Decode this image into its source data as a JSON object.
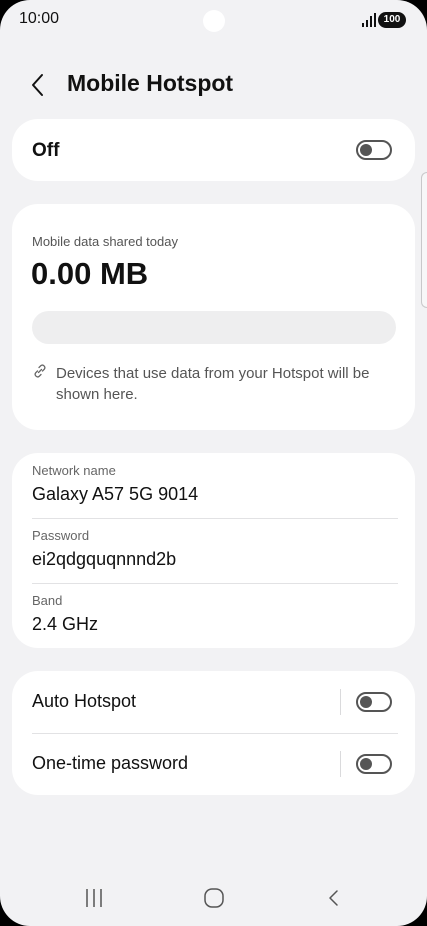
{
  "status_bar": {
    "time": "10:00",
    "battery": "100",
    "signal_icon": "signal-icon"
  },
  "header": {
    "title": "Mobile Hotspot",
    "back_icon": "chevron-left-icon"
  },
  "master_switch": {
    "label": "Off",
    "enabled": false
  },
  "usage": {
    "label": "Mobile data shared today",
    "value": "0.00 MB",
    "progress_fraction": 0,
    "note": "Devices that use data from your Hotspot will be shown here.",
    "note_icon": "link-icon"
  },
  "network": {
    "items": [
      {
        "label": "Network name",
        "value": "Galaxy A57 5G 9014"
      },
      {
        "label": "Password",
        "value": "ei2qdgquqnnnd2b"
      },
      {
        "label": "Band",
        "value": "2.4 GHz"
      }
    ]
  },
  "options": [
    {
      "label": "Auto Hotspot",
      "enabled": false
    },
    {
      "label": "One-time password",
      "enabled": false
    }
  ],
  "nav_bar": {
    "recents_icon": "recents-icon",
    "home_icon": "home-icon",
    "back_icon": "back-icon"
  },
  "colors": {
    "background": "#f2f2f4",
    "card": "#ffffff",
    "text_primary": "#111111",
    "text_secondary": "#555555",
    "toggle_off": "#555555"
  }
}
